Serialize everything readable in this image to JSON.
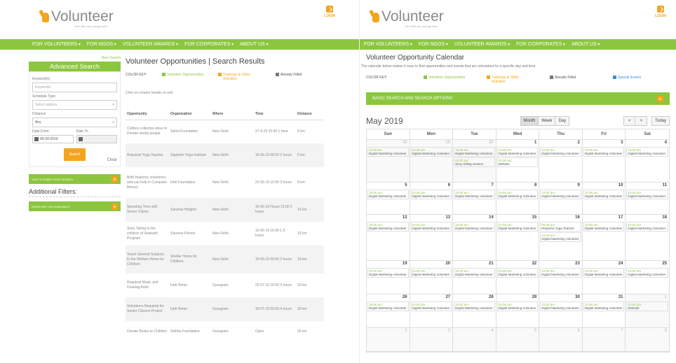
{
  "brand": {
    "name": "Volunteer",
    "tagline": "Your little can change lives",
    "login_label": "LOGIN"
  },
  "nav": {
    "items": [
      "FOR VOLUNTEERS",
      "FOR NGOS",
      "VOLUNTEER AWARDS",
      "FOR CORPORATES",
      "ABOUT US"
    ]
  },
  "search_page": {
    "new_link": "New Search",
    "advanced": {
      "title": "Advanced Search",
      "keyword_label": "Keyword(s)",
      "keyword_placeholder": "Keywords",
      "schedule_label": "Schedule Type",
      "schedule_value": "Select options",
      "distance_label": "Distance",
      "distance_value": "Any",
      "date_from_label": "Date From",
      "date_from_value": "06-09-2019",
      "date_to_label": "Date To",
      "date_to_value": "",
      "search_button": "Search",
      "clear": "Clear",
      "save_share": "SAVE & SHARE YOUR SEARCH",
      "additional_filters": "Additional Filters:",
      "when_available": "WHEN ARE YOU AVAILABLE?"
    },
    "title": "Volunteer Opportunities | Search Results",
    "color_key_label": "COLOR KEY:",
    "color_key": [
      {
        "label": "Volunteer Opportunities",
        "color": "#8cc63f"
      },
      {
        "label": "Trainings & Other Activities",
        "color": "#f2a51e"
      },
      {
        "label": "Already Filled",
        "color": "#777777"
      }
    ],
    "click_hint": "Click on column header to sort.",
    "table": {
      "headers": [
        "Opportunity",
        "Organization",
        "Where",
        "Time",
        "Distance"
      ],
      "rows": [
        {
          "opp": "Clothes collection drive to Donate needy people",
          "org": "Sahni Foundation",
          "where": "New Delhi",
          "time": "27-4-19 15:00 1 hour",
          "dist": "8 km"
        },
        {
          "opp": "Required Yoga Teacher",
          "org": "Saptrishi Yoga Institute",
          "where": "New Delhi",
          "time": "16-05-19 08:00 2 hours",
          "dist": "6 km"
        },
        {
          "opp": "Birth Anatomy volunteers and can help in Computer literacy",
          "org": "Ishti Foundation",
          "where": "New Delhi",
          "time": "22-05-19 10:00 3 hours",
          "dist": "8 km"
        },
        {
          "opp": "Spending Time with Senior Citizen",
          "org": "Sanchar Heights",
          "where": "New Delhi",
          "time": "10-06-19 Hours 15:00 2 hours",
          "dist": "15 km"
        },
        {
          "opp": "Story Telling to the children of Sewnath Program",
          "org": "Sanchar Pehels",
          "where": "New Delhi",
          "time": "10-06-19 16:00 1.5 hours",
          "dist": "15 km"
        },
        {
          "opp": "Teach General Subjects to the Welfare Home for Children",
          "org": "Shelter Home for Children",
          "where": "New Delhi",
          "time": "10-06-19 09:00 2 hours",
          "dist": "15 km"
        },
        {
          "opp": "Required Music and Drawing Artist",
          "org": "Ishti Home",
          "where": "Gurugram",
          "time": "22-07-19 10:00 3 hours",
          "dist": "20 km"
        },
        {
          "opp": "Volunteers Required for Senior Citizens Project",
          "org": "Ishti Home",
          "where": "Gurugram",
          "time": "30-07-19 09:00 4 hours",
          "dist": "20 km"
        },
        {
          "opp": "Donate Books to Children",
          "org": "Shikha Foundation",
          "where": "Gurugram",
          "time": "Open",
          "dist": "25 km"
        }
      ]
    }
  },
  "calendar_page": {
    "title": "Volunteer Opportunity Calendar",
    "desc": "The calendar below makes it easy to find opportunities and events that are scheduled for a specific day and time",
    "color_key_label": "COLOR KEY:",
    "color_key": [
      {
        "label": "Volunteer Opportunities",
        "color": "#8cc63f"
      },
      {
        "label": "Trainings & Other Activities",
        "color": "#f2a51e"
      },
      {
        "label": "Already Filled",
        "color": "#777777"
      },
      {
        "label": "Special Events",
        "color": "#3a8fd8"
      }
    ],
    "basic_search": "BASIC SEARCH AND SEARCH OPTIONS",
    "month": "May 2019",
    "views": [
      "Month",
      "Week",
      "Day"
    ],
    "prev": "<",
    "next": ">",
    "today": "Today",
    "dow": [
      "Sun",
      "Mon",
      "Tue",
      "Wed",
      "Thu",
      "Fri",
      "Sat"
    ],
    "weeks": [
      [
        {
          "n": "28",
          "dim": true,
          "ev": [
            {
              "t": "10:00 am",
              "s": "Digital Marketing Volunteer"
            }
          ]
        },
        {
          "n": "29",
          "dim": true,
          "ev": [
            {
              "t": "10:30 am",
              "s": "Digital Marketing Volunteer"
            }
          ]
        },
        {
          "n": "30",
          "dim": true,
          "ev": [
            {
              "t": "10:00 am",
              "s": "Digital Marketing Volunteer"
            },
            {
              "t": "02:00 pm",
              "s": "Story telling session"
            }
          ]
        },
        {
          "n": "1",
          "ev": [
            {
              "t": "10:00 am",
              "s": "Digital Marketing Volunteer"
            },
            {
              "t": "10:30 am",
              "s": "Website"
            }
          ]
        },
        {
          "n": "2",
          "ev": [
            {
              "t": "10:00 am",
              "s": "Digital Marketing Volunteer"
            }
          ]
        },
        {
          "n": "3",
          "ev": [
            {
              "t": "10:00 am",
              "s": "Digital Marketing Volunteer"
            }
          ]
        },
        {
          "n": "4",
          "ev": [
            {
              "t": "10:00 am",
              "s": "Digital Marketing Volunteer"
            }
          ]
        }
      ],
      [
        {
          "n": "5",
          "ev": [
            {
              "t": "10:00 am",
              "s": "Digital Marketing Volunteer"
            }
          ]
        },
        {
          "n": "6",
          "ev": [
            {
              "t": "10:00 am",
              "s": "Digital Marketing Volunteer"
            }
          ]
        },
        {
          "n": "7",
          "ev": [
            {
              "t": "10:00 am",
              "s": "Digital Marketing Volunteer"
            }
          ]
        },
        {
          "n": "8",
          "ev": [
            {
              "t": "10:00 am",
              "s": "Digital Marketing Volunteer"
            }
          ]
        },
        {
          "n": "9",
          "ev": [
            {
              "t": "10:00 am",
              "s": "Digital Marketing Volunteer"
            }
          ]
        },
        {
          "n": "10",
          "ev": [
            {
              "t": "10:00 am",
              "s": "Digital Marketing Volunteer"
            }
          ]
        },
        {
          "n": "11",
          "ev": [
            {
              "t": "10:00 am",
              "s": "Digital Marketing Volunteer"
            }
          ]
        }
      ],
      [
        {
          "n": "12",
          "ev": [
            {
              "t": "10:00 am",
              "s": "Digital Marketing Volunteer"
            }
          ]
        },
        {
          "n": "13",
          "ev": [
            {
              "t": "10:00 am",
              "s": "Digital Marketing Volunteer"
            }
          ]
        },
        {
          "n": "14",
          "ev": [
            {
              "t": "10:00 am",
              "s": "Digital Marketing Volunteer"
            }
          ]
        },
        {
          "n": "15",
          "ev": [
            {
              "t": "10:00 am",
              "s": "Digital Marketing Volunteer"
            }
          ]
        },
        {
          "n": "16",
          "ev": [
            {
              "t": "08:30 am",
              "s": "Required Yoga Teacher"
            },
            {
              "t": "10:00 am",
              "s": "Digital Marketing Volunteer"
            }
          ]
        },
        {
          "n": "17",
          "ev": [
            {
              "t": "10:00 am",
              "s": "Digital Marketing Volunteer"
            }
          ]
        },
        {
          "n": "18",
          "ev": [
            {
              "t": "10:00 am",
              "s": "Digital Marketing Volunteer"
            }
          ]
        }
      ],
      [
        {
          "n": "19",
          "ev": [
            {
              "t": "10:00 am",
              "s": "Digital Marketing Volunteer"
            }
          ]
        },
        {
          "n": "20",
          "ev": [
            {
              "t": "10:00 am",
              "s": "Digital Marketing Volunteer"
            }
          ]
        },
        {
          "n": "21",
          "ev": [
            {
              "t": "10:00 am",
              "s": "Digital Marketing Volunteer"
            }
          ]
        },
        {
          "n": "22",
          "ev": [
            {
              "t": "10:00 am",
              "s": "Digital Marketing Volunteer"
            }
          ]
        },
        {
          "n": "23",
          "ev": [
            {
              "t": "10:00 am",
              "s": "Digital Marketing Volunteer"
            }
          ]
        },
        {
          "n": "24",
          "ev": [
            {
              "t": "10:00 am",
              "s": "Digital Marketing Volunteer"
            }
          ]
        },
        {
          "n": "25",
          "ev": [
            {
              "t": "10:00 am",
              "s": "Digital Marketing Volunteer"
            }
          ]
        }
      ],
      [
        {
          "n": "26",
          "ev": [
            {
              "t": "10:00 am",
              "s": "Digital Marketing Volunteer"
            }
          ]
        },
        {
          "n": "27",
          "ev": [
            {
              "t": "10:00 am",
              "s": "Digital Marketing Volunteer"
            }
          ]
        },
        {
          "n": "28",
          "ev": [
            {
              "t": "10:00 am",
              "s": "Digital Marketing Volunteer"
            }
          ]
        },
        {
          "n": "29",
          "ev": [
            {
              "t": "10:00 am",
              "s": "Digital Marketing Volunteer"
            }
          ]
        },
        {
          "n": "30",
          "ev": [
            {
              "t": "10:00 am",
              "s": "Digital Marketing Volunteer"
            }
          ]
        },
        {
          "n": "31",
          "ev": [
            {
              "t": "10:00 am",
              "s": "Digital Marketing Volunteer"
            }
          ]
        },
        {
          "n": "1",
          "dim": true,
          "ev": [
            {
              "t": "10:00 am",
              "s": "Website"
            }
          ]
        }
      ],
      [
        {
          "n": "2",
          "dim": true,
          "ev": []
        },
        {
          "n": "3",
          "dim": true,
          "ev": []
        },
        {
          "n": "4",
          "dim": true,
          "ev": []
        },
        {
          "n": "5",
          "dim": true,
          "ev": []
        },
        {
          "n": "6",
          "dim": true,
          "ev": []
        },
        {
          "n": "7",
          "dim": true,
          "ev": []
        },
        {
          "n": "8",
          "dim": true,
          "ev": []
        }
      ]
    ]
  }
}
